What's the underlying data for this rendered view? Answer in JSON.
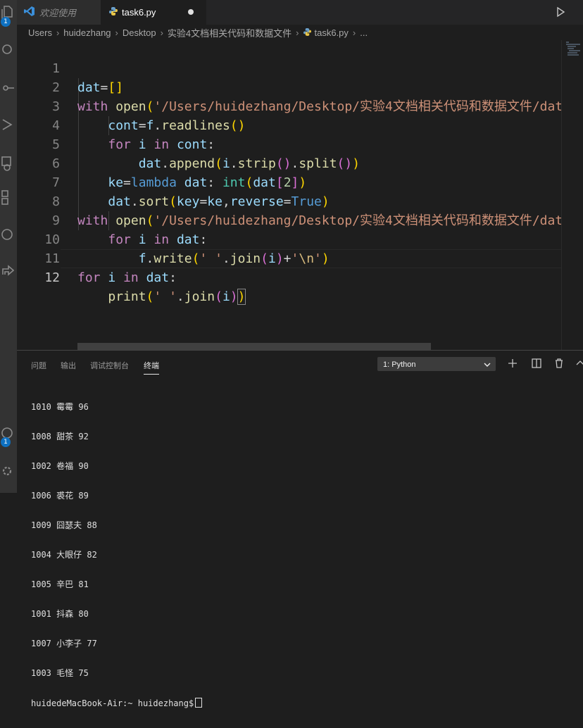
{
  "tabs": [
    {
      "label": "欢迎使用",
      "icon": "vscode-logo-icon"
    },
    {
      "label": "task6.py",
      "icon": "python-icon"
    }
  ],
  "breadcrumb": [
    "Users",
    "huidezhang",
    "Desktop",
    "实验4文档相关代码和数据文件",
    "task6.py",
    "..."
  ],
  "editor": {
    "line_numbers": [
      "1",
      "2",
      "3",
      "4",
      "5",
      "6",
      "7",
      "8",
      "9",
      "10",
      "11",
      "12"
    ],
    "lines": [
      "dat=[]",
      "with open('/Users/huidezhang/Desktop/实验4文档相关代码和数据文件/dat",
      "    cont=f.readlines()",
      "    for i in cont:",
      "        dat.append(i.strip().split())",
      "    ke=lambda dat: int(dat[2])",
      "    dat.sort(key=ke,reverse=True)",
      "with open('/Users/huidezhang/Desktop/实验4文档相关代码和数据文件/dat",
      "    for i in dat:",
      "        f.write(' '.join(i)+'\\n')",
      "for i in dat:",
      "    print(' '.join(i))"
    ]
  },
  "panel": {
    "tabs": [
      "问题",
      "输出",
      "调试控制台",
      "终端"
    ],
    "active_tab": "终端",
    "terminal_select": "1: Python",
    "terminal_output": [
      "1010 霉霉 96",
      "1008 甜茶 92",
      "1002 卷福 90",
      "1006 裘花 89",
      "1009 囧瑟夫 88",
      "1004 大眼仔 82",
      "1005 辛巴 81",
      "1001 抖森 80",
      "1007 小李子 77",
      "1003 毛怪 75"
    ],
    "prompt": "huidedeMacBook-Air:~ huidezhang$"
  },
  "activity_badges": [
    "1",
    "1"
  ],
  "colors": {
    "background": "#1e1e1e",
    "activity_bar": "#333333",
    "accent_badge": "#0e70c0",
    "keyword": "#c586c0",
    "string": "#ce9178",
    "function": "#dcdcaa",
    "variable": "#9cdcfe"
  }
}
